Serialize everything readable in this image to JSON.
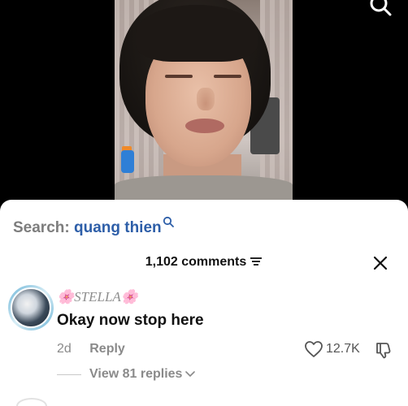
{
  "search": {
    "label": "Search:",
    "term": "quang thien"
  },
  "comments": {
    "count_label": "1,102 comments"
  },
  "comment": {
    "username": "🌸STELLA🌸",
    "text": "Okay now stop here",
    "age": "2d",
    "reply_label": "Reply",
    "likes": "12.7K",
    "view_replies": "View 81 replies"
  },
  "icons": {
    "top_right": "search-icon",
    "inline_search": "search-icon",
    "filter": "filter-icon",
    "close": "close-icon",
    "like": "heart-icon",
    "dislike": "dislike-icon",
    "expand": "chevron-down-icon"
  },
  "colors": {
    "search_term": "#2d5ea8",
    "muted": "#8a8a8a",
    "sheet_background": "#ffffff",
    "video_background": "#000000"
  }
}
